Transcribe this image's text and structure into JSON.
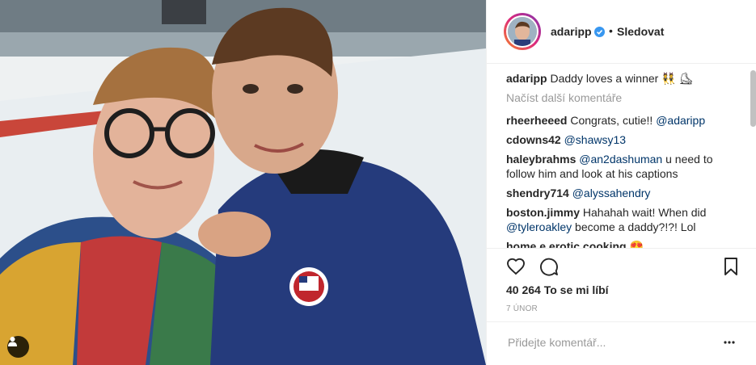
{
  "header": {
    "username": "adaripp",
    "separator": "•",
    "follow_label": "Sledovat"
  },
  "caption": {
    "username": "adaripp",
    "text": "Daddy loves a winner 👯 ⛸"
  },
  "load_more": "Načíst další komentáře",
  "comments": [
    {
      "user": "rheerheeed",
      "pre": "Congrats, cutie!! ",
      "mention": "@adaripp",
      "post": ""
    },
    {
      "user": "cdowns42",
      "pre": "",
      "mention": "@shawsy13",
      "post": ""
    },
    {
      "user": "haleybrahms",
      "pre": "",
      "mention": "@an2dashuman",
      "post": " u need to follow him and look at his captions"
    },
    {
      "user": "shendry714",
      "pre": "",
      "mention": "@alyssahendry",
      "post": ""
    },
    {
      "user": "boston.jimmy",
      "pre": "Hahahah wait! When did ",
      "mention": "@tyleroakley",
      "post": " become a daddy?!?! Lol"
    },
    {
      "user": "home.e.erotic.cooking",
      "pre": "😍",
      "mention": "",
      "post": ""
    }
  ],
  "likes": "40 264 To se mi líbí",
  "date": "7 ÚNOR",
  "add_comment_placeholder": "Přidejte komentář...",
  "icons": {
    "tag": "user-tag-icon",
    "verified": "verified-badge-icon",
    "like": "heart-icon",
    "comment": "comment-bubble-icon",
    "save": "bookmark-icon",
    "more": "more-options-icon"
  },
  "colors": {
    "accent": "#3897f0",
    "text": "#262626",
    "muted": "#999999",
    "link": "#003569"
  }
}
